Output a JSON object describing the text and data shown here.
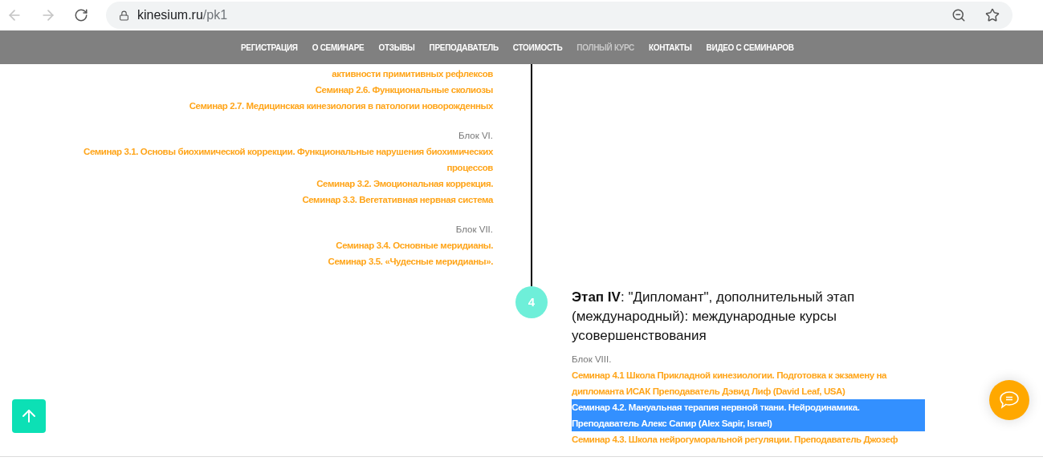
{
  "browser": {
    "url_host": "kinesium.ru",
    "url_path": "/pk1"
  },
  "nav": {
    "items": [
      {
        "label": "РЕГИСТРАЦИЯ",
        "selected": false
      },
      {
        "label": "О СЕМИНАРЕ",
        "selected": false
      },
      {
        "label": "ОТЗЫВЫ",
        "selected": false
      },
      {
        "label": "ПРЕПОДАВАТЕЛЬ",
        "selected": false
      },
      {
        "label": "СТОИМОСТЬ",
        "selected": false
      },
      {
        "label": "ПОЛНЫЙ КУРС",
        "selected": true
      },
      {
        "label": "КОНТАКТЫ",
        "selected": false
      },
      {
        "label": "ВИДЕО С СЕМИНАРОВ",
        "selected": false
      }
    ]
  },
  "left_blocks": [
    {
      "items": [
        {
          "text": "активности примитивных рефлексов",
          "selected": false
        },
        {
          "text": "Семинар 2.6. Функциональные сколиозы",
          "selected": false
        },
        {
          "text": "Семинар 2.7. Медицинская кинезиология в патологии новорожденных",
          "selected": false
        }
      ]
    },
    {
      "label": "Блок VI.",
      "items": [
        {
          "text": "Семинар 3.1. Основы биохимической коррекции. Функциональные нарушения биохимических процессов",
          "selected": false
        },
        {
          "text": "Семинар 3.2. Эмоциональная коррекция.",
          "selected": false
        },
        {
          "text": "Семинар 3.3. Вегетативная нервная система",
          "selected": false
        }
      ]
    },
    {
      "label": "Блок VII.",
      "items": [
        {
          "text": "Семинар 3.4. Основные меридианы.",
          "selected": false
        },
        {
          "text": "Семинар 3.5. «Чудесные меридианы».",
          "selected": false
        }
      ]
    }
  ],
  "stage": {
    "number": "4",
    "title": "**Этап IV**: \"Дипломант\", дополнительный этап (международный): международные курсы усовершенствования",
    "blocks": [
      {
        "label": "Блок VIII.",
        "items": [
          {
            "text": "Семинар 4.1 Школа Прикладной кинезиологии. Подготовка к экзамену на дипломанта ИСАК Преподаватель Дэвид Лиф (David Leaf, USA)",
            "selected": false
          },
          {
            "text": "Семинар 4.2. Мануальная терапия нервной ткани. Нейродинамика. Преподаватель Алекс Сапир (Alex Sapir, Israel)",
            "selected": true
          },
          {
            "text": "Семинар 4.3. Школа нейрогуморальной регуляции. Преподаватель Джозеф",
            "selected": false
          }
        ]
      }
    ]
  }
}
